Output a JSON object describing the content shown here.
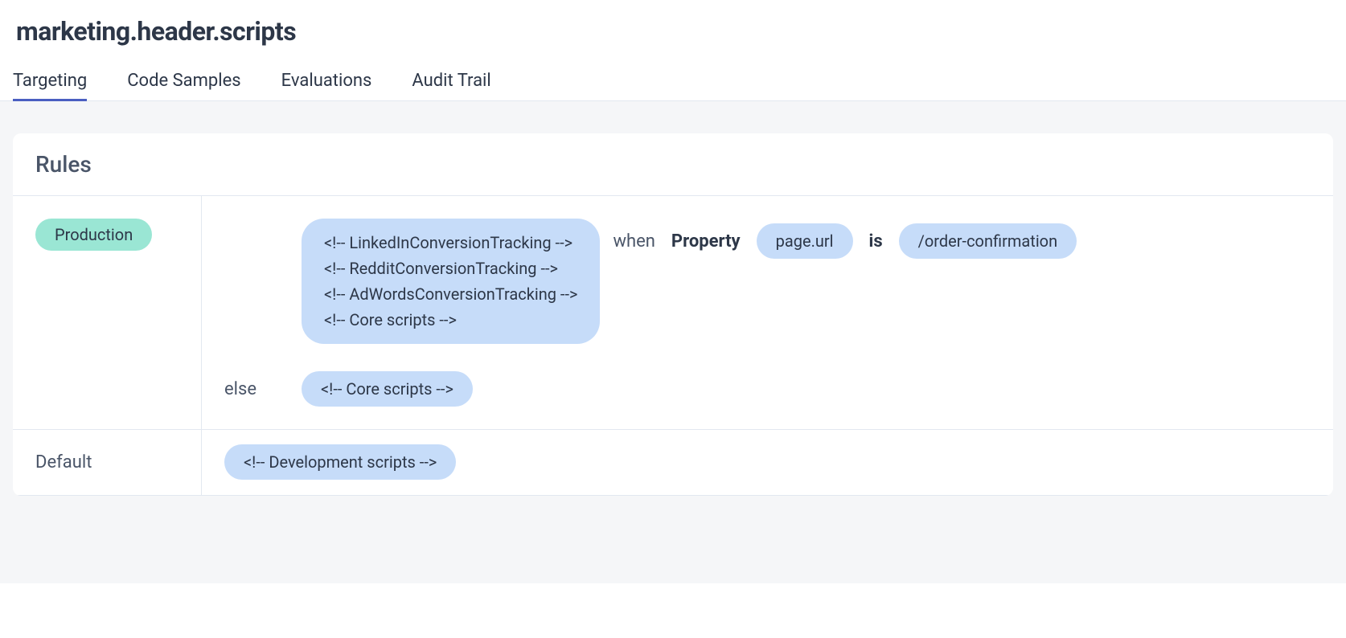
{
  "page": {
    "title": "marketing.header.scripts"
  },
  "tabs": [
    {
      "label": "Targeting",
      "active": true
    },
    {
      "label": "Code Samples",
      "active": false
    },
    {
      "label": "Evaluations",
      "active": false
    },
    {
      "label": "Audit Trail",
      "active": false
    }
  ],
  "rules": {
    "section_title": "Rules",
    "rows": [
      {
        "environment": "Production",
        "clauses": [
          {
            "type": "when",
            "value_lines": [
              "<!-- LinkedInConversionTracking -->",
              "<!-- RedditConversionTracking -->",
              "<!-- AdWordsConversionTracking -->",
              "<!-- Core scripts -->"
            ],
            "condition": {
              "when_label": "when",
              "property_label": "Property",
              "property_value": "page.url",
              "operator": "is",
              "match_value": "/order-confirmation"
            }
          },
          {
            "type": "else",
            "else_label": "else",
            "value": "<!-- Core scripts -->"
          }
        ]
      },
      {
        "default_label": "Default",
        "default_value": "<!-- Development scripts -->"
      }
    ]
  }
}
